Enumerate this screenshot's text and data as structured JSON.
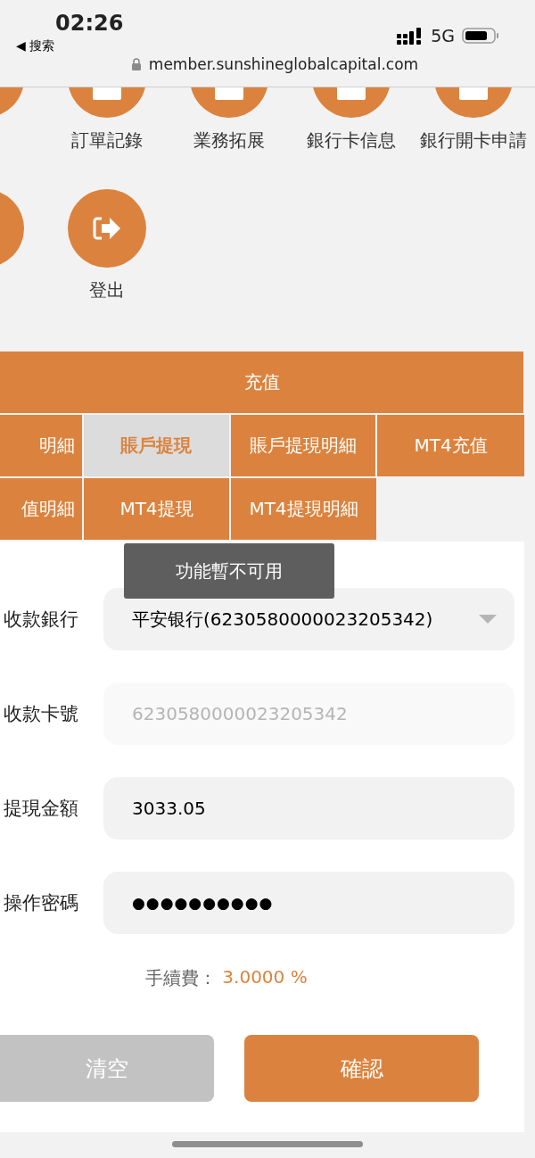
{
  "status_bar": {
    "time": "02:26",
    "back": {
      "arrow": "◀",
      "label": "搜索"
    },
    "network": "5G",
    "url": "member.sunshineglobalcapital.com"
  },
  "menu_rows": [
    {
      "items": [
        {
          "kind": "cut"
        },
        {
          "kind": "doc",
          "label": "訂單記錄"
        },
        {
          "kind": "doc",
          "label": "業務拓展"
        },
        {
          "kind": "doc",
          "label": "銀行卡信息"
        },
        {
          "kind": "doc",
          "label": "銀行開卡申請"
        }
      ]
    },
    {
      "items": [
        {
          "kind": "cut"
        },
        {
          "kind": "logout",
          "label": "登出"
        }
      ]
    }
  ],
  "tabs": [
    [
      {
        "label": "充值",
        "selected": false
      }
    ],
    [
      {
        "label": "明細",
        "selected": false
      },
      {
        "label": "賬戶提現",
        "selected": true
      },
      {
        "label": "賬戶提現明細",
        "selected": false
      },
      {
        "label": "MT4充值",
        "selected": false
      }
    ],
    [
      {
        "label": "值明細",
        "selected": false
      },
      {
        "label": "MT4提現",
        "selected": false
      },
      {
        "label": "MT4提現明細",
        "selected": false
      }
    ]
  ],
  "form": {
    "fields": [
      {
        "label": "收款銀行",
        "kind": "select",
        "value": "平安银行(6230580000023205342)"
      },
      {
        "label": "收款卡號",
        "kind": "readonly",
        "value": "6230580000023205342"
      },
      {
        "label": "提現金額",
        "kind": "input",
        "value": "3033.05"
      },
      {
        "label": "操作密碼",
        "kind": "password",
        "value": "●●●●●●●●●●"
      }
    ],
    "fee": {
      "label": "手續費：",
      "value": "3.0000 %"
    },
    "buttons": [
      {
        "label": "清空",
        "disabled": true
      },
      {
        "label": "確認",
        "disabled": false
      }
    ]
  },
  "toast": "功能暫不可用"
}
